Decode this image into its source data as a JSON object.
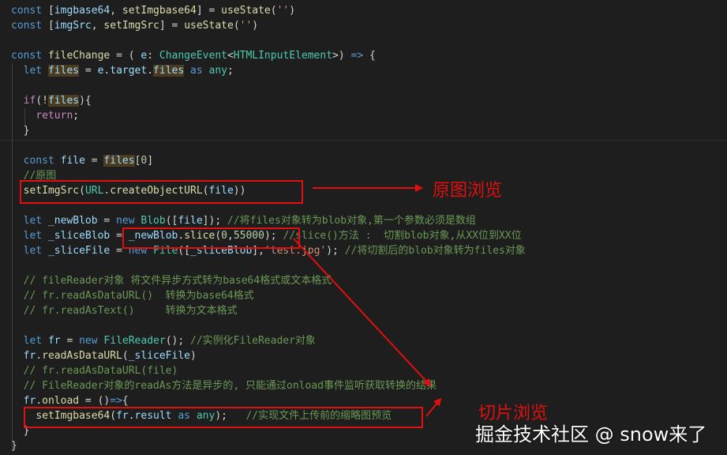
{
  "colors": {
    "background": "#1e1e1e",
    "keyword": "#569cd6",
    "control": "#c586c0",
    "variable": "#9cdcfe",
    "function": "#dcdcaa",
    "type": "#4ec9b0",
    "string": "#ce9178",
    "number": "#b5cea8",
    "comment": "#6a9955",
    "punct": "#d4d4d4",
    "annotation": "#e0100f"
  },
  "code_lines": [
    [
      [
        "keyword",
        "const"
      ],
      [
        "punct",
        " ["
      ],
      [
        "variable",
        "imgbase64"
      ],
      [
        "punct",
        ", "
      ],
      [
        "function",
        "setImgbase64"
      ],
      [
        "punct",
        "] = "
      ],
      [
        "function",
        "useState"
      ],
      [
        "punct",
        "("
      ],
      [
        "string",
        "''"
      ],
      [
        "punct",
        ")"
      ]
    ],
    [
      [
        "keyword",
        "const"
      ],
      [
        "punct",
        " ["
      ],
      [
        "variable",
        "imgSrc"
      ],
      [
        "punct",
        ", "
      ],
      [
        "function",
        "setImgSrc"
      ],
      [
        "punct",
        "] = "
      ],
      [
        "function",
        "useState"
      ],
      [
        "punct",
        "("
      ],
      [
        "string",
        "''"
      ],
      [
        "punct",
        ")"
      ]
    ],
    [],
    [
      [
        "keyword",
        "const"
      ],
      [
        "punct",
        " "
      ],
      [
        "function",
        "fileChange"
      ],
      [
        "punct",
        " = ( "
      ],
      [
        "variable",
        "e"
      ],
      [
        "punct",
        ": "
      ],
      [
        "type",
        "ChangeEvent"
      ],
      [
        "punct",
        "<"
      ],
      [
        "type",
        "HTMLInputElement"
      ],
      [
        "punct",
        ">) "
      ],
      [
        "keyword",
        "=>"
      ],
      [
        "punct",
        " {"
      ]
    ],
    [
      [
        "punct",
        "  "
      ],
      [
        "keyword",
        "let"
      ],
      [
        "punct",
        " "
      ],
      [
        "variable",
        "files"
      ],
      [
        "punct",
        " = "
      ],
      [
        "variable",
        "e"
      ],
      [
        "punct",
        "."
      ],
      [
        "variable",
        "target"
      ],
      [
        "punct",
        "."
      ],
      [
        "variable",
        "files"
      ],
      [
        "punct",
        " "
      ],
      [
        "keyword",
        "as"
      ],
      [
        "punct",
        " "
      ],
      [
        "type",
        "any"
      ],
      [
        "punct",
        ";"
      ]
    ],
    [],
    [
      [
        "punct",
        "  "
      ],
      [
        "control",
        "if"
      ],
      [
        "punct",
        "(!"
      ],
      [
        "variable",
        "files"
      ],
      [
        "punct",
        "){"
      ]
    ],
    [
      [
        "punct",
        "    "
      ],
      [
        "control",
        "return"
      ],
      [
        "punct",
        ";"
      ]
    ],
    [
      [
        "punct",
        "  }"
      ]
    ],
    [],
    [
      [
        "punct",
        "  "
      ],
      [
        "keyword",
        "const"
      ],
      [
        "punct",
        " "
      ],
      [
        "variable",
        "file"
      ],
      [
        "punct",
        " = "
      ],
      [
        "variable",
        "files"
      ],
      [
        "punct",
        "["
      ],
      [
        "number",
        "0"
      ],
      [
        "punct",
        "]"
      ]
    ],
    [
      [
        "punct",
        "  "
      ],
      [
        "comment",
        "//原图"
      ]
    ],
    [
      [
        "punct",
        "  "
      ],
      [
        "function",
        "setImgSrc"
      ],
      [
        "punct",
        "("
      ],
      [
        "type",
        "URL"
      ],
      [
        "punct",
        "."
      ],
      [
        "function",
        "createObjectURL"
      ],
      [
        "punct",
        "("
      ],
      [
        "variable",
        "file"
      ],
      [
        "punct",
        "))"
      ]
    ],
    [],
    [
      [
        "punct",
        "  "
      ],
      [
        "keyword",
        "let"
      ],
      [
        "punct",
        " "
      ],
      [
        "variable",
        "_newBlob"
      ],
      [
        "punct",
        " = "
      ],
      [
        "keyword",
        "new"
      ],
      [
        "punct",
        " "
      ],
      [
        "type",
        "Blob"
      ],
      [
        "punct",
        "(["
      ],
      [
        "variable",
        "file"
      ],
      [
        "punct",
        "]); "
      ],
      [
        "comment",
        "//将files对象转为blob对象,第一个参数必须是数组"
      ]
    ],
    [
      [
        "punct",
        "  "
      ],
      [
        "keyword",
        "let"
      ],
      [
        "punct",
        " "
      ],
      [
        "variable",
        "_sliceBlob"
      ],
      [
        "punct",
        " = "
      ],
      [
        "variable",
        "_newBlob"
      ],
      [
        "punct",
        "."
      ],
      [
        "function",
        "slice"
      ],
      [
        "punct",
        "("
      ],
      [
        "number",
        "0"
      ],
      [
        "punct",
        ","
      ],
      [
        "number",
        "55000"
      ],
      [
        "punct",
        "); "
      ],
      [
        "comment",
        "//slice()方法 :  切割blob对象,从XX位到XX位"
      ]
    ],
    [
      [
        "punct",
        "  "
      ],
      [
        "keyword",
        "let"
      ],
      [
        "punct",
        " "
      ],
      [
        "variable",
        "_sliceFile"
      ],
      [
        "punct",
        " = "
      ],
      [
        "keyword",
        "new"
      ],
      [
        "punct",
        " "
      ],
      [
        "type",
        "File"
      ],
      [
        "punct",
        "(["
      ],
      [
        "variable",
        "_sliceBlob"
      ],
      [
        "punct",
        "],"
      ],
      [
        "string",
        "'test.jpg'"
      ],
      [
        "punct",
        "); "
      ],
      [
        "comment",
        "//将切割后的blob对象转为files对象"
      ]
    ],
    [],
    [
      [
        "punct",
        "  "
      ],
      [
        "comment",
        "// fileReader对象 将文件异步方式转为base64格式或文本格式"
      ]
    ],
    [
      [
        "punct",
        "  "
      ],
      [
        "comment",
        "// fr.readAsDataURL()  转换为base64格式"
      ]
    ],
    [
      [
        "punct",
        "  "
      ],
      [
        "comment",
        "// fr.readAsText()     转换为文本格式"
      ]
    ],
    [],
    [
      [
        "punct",
        "  "
      ],
      [
        "keyword",
        "let"
      ],
      [
        "punct",
        " "
      ],
      [
        "variable",
        "fr"
      ],
      [
        "punct",
        " = "
      ],
      [
        "keyword",
        "new"
      ],
      [
        "punct",
        " "
      ],
      [
        "type",
        "FileReader"
      ],
      [
        "punct",
        "(); "
      ],
      [
        "comment",
        "//实例化FileReader对象"
      ]
    ],
    [
      [
        "punct",
        "  "
      ],
      [
        "variable",
        "fr"
      ],
      [
        "punct",
        "."
      ],
      [
        "function",
        "readAsDataURL"
      ],
      [
        "punct",
        "("
      ],
      [
        "variable",
        "_sliceFile"
      ],
      [
        "punct",
        ")"
      ]
    ],
    [
      [
        "punct",
        "  "
      ],
      [
        "comment",
        "// fr.readAsDataURL(file)"
      ]
    ],
    [
      [
        "punct",
        "  "
      ],
      [
        "comment",
        "// FileReader对象的readAs方法是异步的, 只能通过onload事件监听获取转换的结果"
      ]
    ],
    [
      [
        "punct",
        "  "
      ],
      [
        "variable",
        "fr"
      ],
      [
        "punct",
        "."
      ],
      [
        "function",
        "onload"
      ],
      [
        "punct",
        " = ()"
      ],
      [
        "keyword",
        "=>"
      ],
      [
        "punct",
        "{"
      ]
    ],
    [
      [
        "punct",
        "    "
      ],
      [
        "function",
        "setImgbase64"
      ],
      [
        "punct",
        "("
      ],
      [
        "variable",
        "fr"
      ],
      [
        "punct",
        "."
      ],
      [
        "variable",
        "result"
      ],
      [
        "punct",
        " "
      ],
      [
        "keyword",
        "as"
      ],
      [
        "punct",
        " "
      ],
      [
        "type",
        "any"
      ],
      [
        "punct",
        ");   "
      ],
      [
        "comment",
        "//实现文件上传前的缩略图预览"
      ]
    ],
    [
      [
        "punct",
        "  }"
      ]
    ],
    [
      [
        "punct",
        "}"
      ]
    ]
  ],
  "annotations": {
    "original_preview": "原图浏览",
    "slice_preview": "切片浏览"
  },
  "watermark": "掘金技术社区 @ snow来了"
}
